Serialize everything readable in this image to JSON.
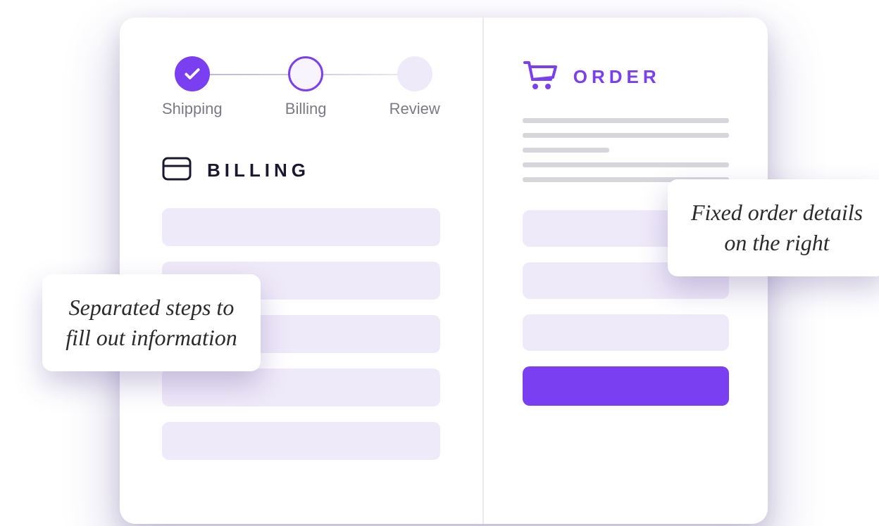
{
  "stepper": {
    "step1": {
      "label": "Shipping",
      "state": "done"
    },
    "step2": {
      "label": "Billing",
      "state": "active"
    },
    "step3": {
      "label": "Review",
      "state": "upcoming"
    }
  },
  "billing": {
    "heading": "BILLING"
  },
  "order": {
    "heading": "ORDER"
  },
  "callouts": {
    "left": "Separated steps to fill out information",
    "right": "Fixed order details on the right"
  }
}
